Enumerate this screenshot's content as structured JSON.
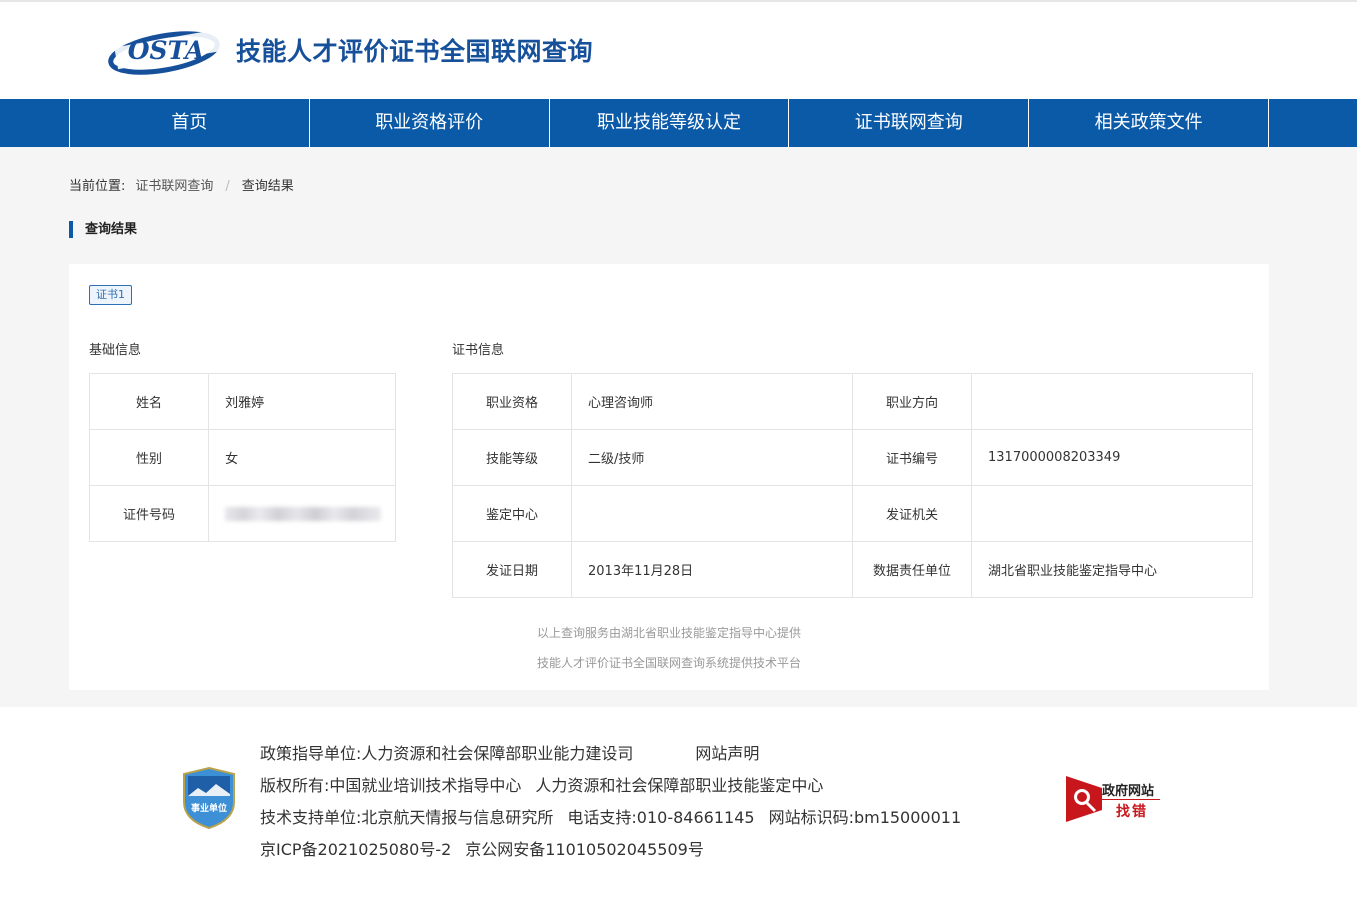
{
  "header": {
    "logo_text": "OSTA",
    "site_title": "技能人才评价证书全国联网查询"
  },
  "nav": [
    {
      "label": "首页"
    },
    {
      "label": "职业资格评价"
    },
    {
      "label": "职业技能等级认定"
    },
    {
      "label": "证书联网查询"
    },
    {
      "label": "相关政策文件"
    }
  ],
  "breadcrumb": {
    "prefix": "当前位置:",
    "link": "证书联网查询",
    "separator": "/",
    "current": "查询结果"
  },
  "section_title": "查询结果",
  "result": {
    "tag": "证书1",
    "basic_title": "基础信息",
    "cert_title": "证书信息",
    "basic": [
      {
        "label": "姓名",
        "value": "刘雅婷"
      },
      {
        "label": "性别",
        "value": "女"
      },
      {
        "label": "证件号码",
        "value": ""
      }
    ],
    "cert": [
      {
        "l1": "职业资格",
        "v1": "心理咨询师",
        "l2": "职业方向",
        "v2": ""
      },
      {
        "l1": "技能等级",
        "v1": "二级/技师",
        "l2": "证书编号",
        "v2": "1317000008203349"
      },
      {
        "l1": "鉴定中心",
        "v1": "",
        "l2": "发证机关",
        "v2": ""
      },
      {
        "l1": "发证日期",
        "v1": "2013年11月28日",
        "l2": "数据责任单位",
        "v2": "湖北省职业技能鉴定指导中心"
      }
    ],
    "note1": "以上查询服务由湖北省职业技能鉴定指导中心提供",
    "note2": "技能人才评价证书全国联网查询系统提供技术平台"
  },
  "footer": {
    "badge_text": "事业单位",
    "policy_unit": "政策指导单位:人力资源和社会保障部职业能力建设司",
    "statement": "网站声明",
    "copyright_a": "版权所有:中国就业培训技术指导中心",
    "copyright_b": "人力资源和社会保障部职业技能鉴定中心",
    "tech_support": "技术支持单位:北京航天情报与信息研究所",
    "phone": "电话支持:010-84661145",
    "site_id": "网站标识码:bm15000011",
    "icp": "京ICP备2021025080号-2",
    "police": "京公网安备11010502045509号",
    "zhaocuo_1": "政府网站",
    "zhaocuo_2": "找错"
  },
  "colors": {
    "nav_bg": "#0b5aa8",
    "title_blue": "#17509a",
    "content_bg": "#f5f5f5",
    "zhaocuo_red": "#c8161d"
  }
}
